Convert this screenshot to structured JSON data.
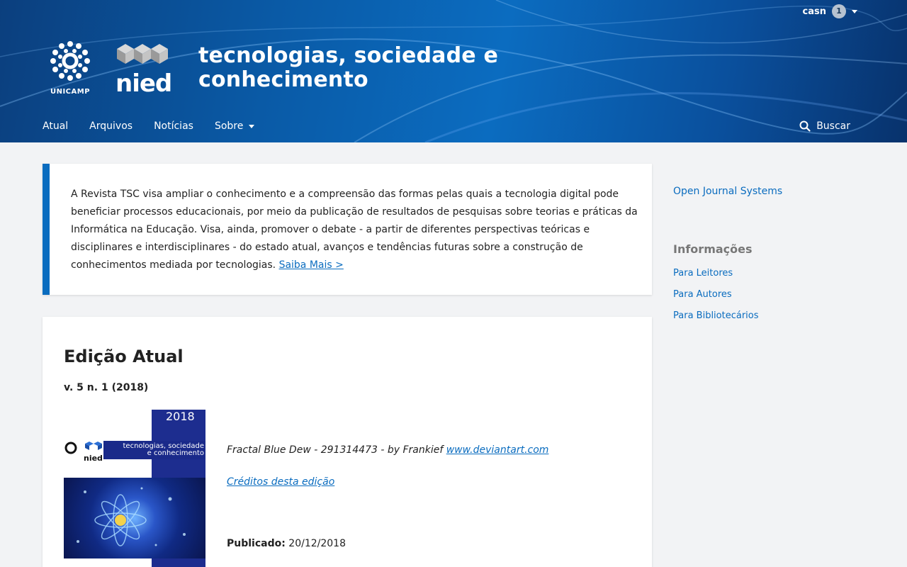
{
  "user": {
    "name": "casn",
    "notifications": "1"
  },
  "header": {
    "unicamp_label": "UNICAMP",
    "nied_label": "nied",
    "title_line1": "tecnologias, sociedade e",
    "title_line2": "conhecimento"
  },
  "nav": {
    "items": [
      {
        "label": "Atual"
      },
      {
        "label": "Arquivos"
      },
      {
        "label": "Notícias"
      },
      {
        "label": "Sobre"
      }
    ],
    "search_label": "Buscar"
  },
  "about": {
    "text": "A Revista TSC visa ampliar o conhecimento e a compreensão das formas pelas quais a tecnologia digital pode beneficiar processos educacionais, por meio da publicação de resultados de pesquisas sobre teorias e práticas da Informática na Educação. Visa, ainda, promover o debate - a partir de diferentes perspectivas teóricas e disciplinares e interdisciplinares - do estado atual, avanços e tendências futuras sobre a construção de conhecimentos mediada por tecnologias.",
    "link_label": "Saiba Mais >"
  },
  "issue": {
    "heading": "Edição Atual",
    "number": "v. 5 n. 1 (2018)",
    "cover": {
      "year": "2018",
      "title_line1": "tecnologias, sociedade",
      "title_line2": "e conhecimento",
      "nied": "nied"
    },
    "description_text": "Fractal Blue Dew - 291314473 - by Frankief",
    "description_link": "www.deviantart.com",
    "credits_link": "Créditos desta edição",
    "published_label": "Publicado:",
    "published_date": "20/12/2018"
  },
  "sidebar": {
    "ojs_link": "Open Journal Systems",
    "info_heading": "Informações",
    "links": [
      {
        "label": "Para Leitores"
      },
      {
        "label": "Para Autores"
      },
      {
        "label": "Para Bibliotecários"
      }
    ]
  },
  "colors": {
    "accent": "#0a6cbf",
    "header_bg": "#0a5aa6",
    "page_bg": "#f2f3f5"
  }
}
